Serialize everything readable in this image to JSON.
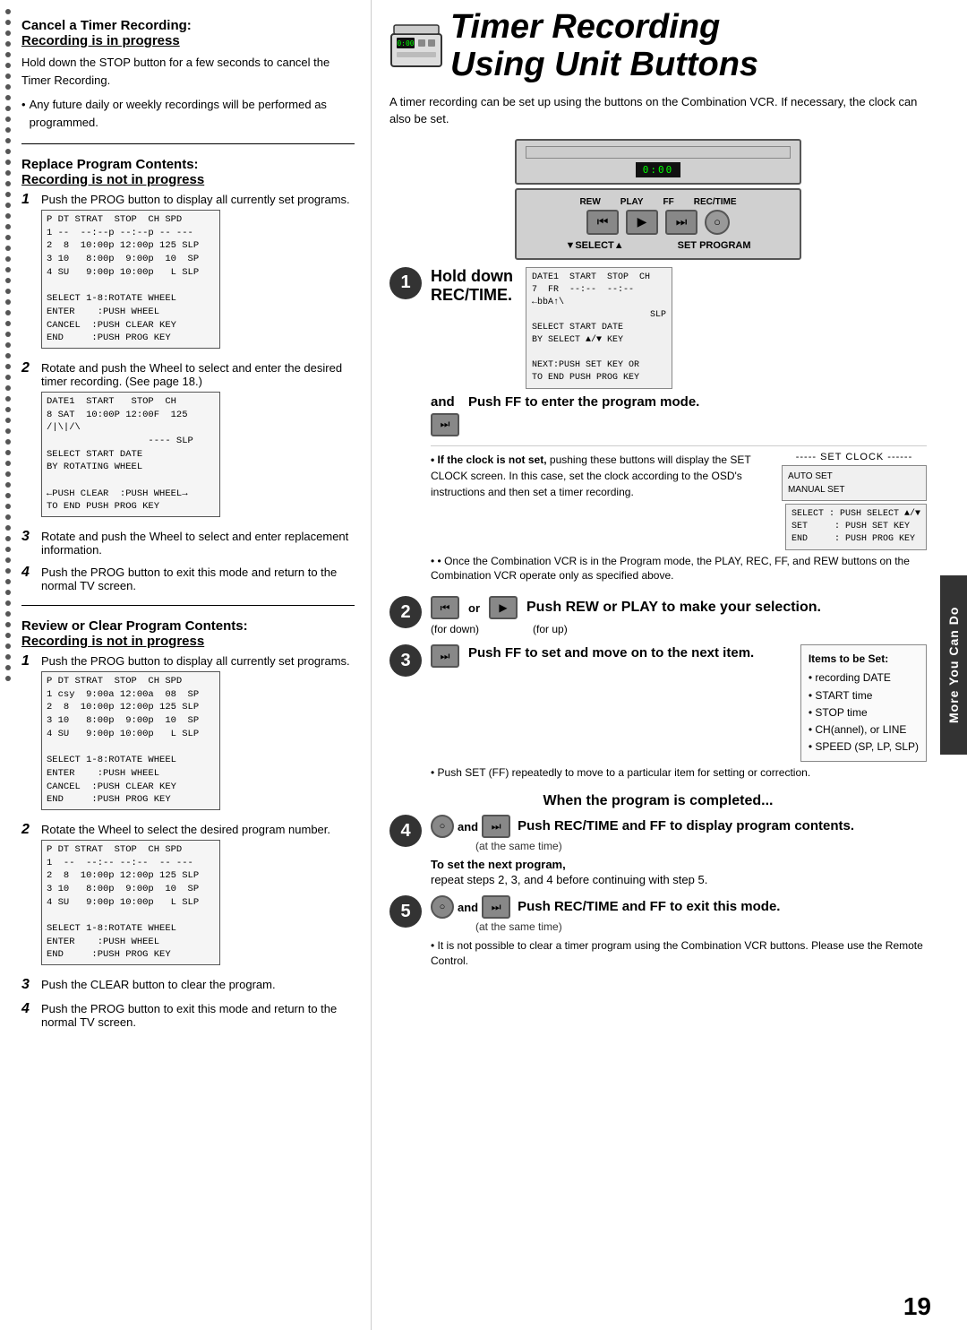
{
  "page": {
    "number": "19"
  },
  "title": {
    "line1": "Timer Recording",
    "line2": "Using Unit Buttons"
  },
  "right_sidebar_label": "More You Can Do",
  "intro": "A timer recording can be set up using the buttons on the Combination VCR. If necessary, the clock can also be set.",
  "vcr": {
    "display_text": "0:00",
    "button_labels": [
      "REW",
      "PLAY",
      "FF",
      "REC/TIME"
    ],
    "nav_label_left": "▼SELECT▲",
    "nav_label_right": "SET  PROGRAM"
  },
  "left": {
    "section1": {
      "title": "Cancel a Timer Recording:",
      "title2": "Recording is in progress",
      "body": "Hold down the STOP button for a few seconds to cancel the Timer Recording.",
      "bullet": "Any future daily or weekly recordings will be performed as programmed."
    },
    "section2": {
      "title": "Replace Program Contents:",
      "title2": "Recording is not in progress",
      "steps": [
        {
          "num": "1",
          "text_before": "Push the PROG button to display all currently set programs.",
          "screen": "P DT STRAT  STOP  CH SPD\n1 --  --:--p --:--p -- ---\n2  8  10:00p 12:00p 125 SLP\n3 10   8:00p  9:00p  10  SP\n4 SU   9:00p 10:00p   L SLP\n\nSELECT 1-8:ROTATE WHEEL\nENTER   :PUSH WHEEL\nCANCEL  :PUSH CLEAR KEY\nEND     :PUSH PROG KEY"
        },
        {
          "num": "2",
          "text_before": "Rotate and push the Wheel to select and enter the desired timer recording. (See page 18.)",
          "screen1": "DATE1  START   STOP  CH\n8 SAT  10:00P 12:00F  125\n/|\\|/\\\n                  ---- SLP\nSELECT START DATE\nBY ROTATING WHEEL\n\n←PUSH CLEAR  :PUSH WHEEL→\nTO END PUSH PROG KEY"
        },
        {
          "num": "3",
          "text_before": "Rotate and push the Wheel to select and enter replacement information."
        },
        {
          "num": "4",
          "text_before": "Push the PROG button to exit this mode and return to the normal TV screen."
        }
      ]
    },
    "section3": {
      "title": "Review or Clear Program Contents:",
      "title2": "Recording is not in progress",
      "steps": [
        {
          "num": "1",
          "text_before": "Push the PROG button to display all currently set programs.",
          "screen": "P DT STRAT  STOP  CH SPD\n1 csy  9:00a 12:00a  08  SP\n2  8  10:00p 12:00p 125 SLP\n3 10   8:00p  9:00p  10  SP\n4 SU   9:00p 10:00p   L SLP\n\nSELECT 1-8:ROTATE WHEEL\nENTER   :PUSH WHEEL\nCANCEL  :PUSH CLEAR KEY\nEND     :PUSH PROG KEY"
        },
        {
          "num": "2",
          "text_before": "Rotate the Wheel to select the desired program number.",
          "screen": "P DT STRAT  STOP  CH SPD\n1  --  --:-- --:--  -- ---\n2  8  10:00p 12:00p 125 SLP\n3 10   8:00p  9:00p  10  SP\n4 SU   9:00p 10:00p   L SLP\n\nSELECT 1-8:ROTATE WHEEL\nENTER   :PUSH WHEEL\nEND     :PUSH PROG KEY"
        },
        {
          "num": "3",
          "text_before": "Push the CLEAR button to clear the program."
        },
        {
          "num": "4",
          "text_before": "Push the PROG button to exit this mode and return to the normal TV screen."
        }
      ]
    }
  },
  "right": {
    "step1": {
      "circle": "1",
      "title": "Hold down",
      "subtitle": "REC/TIME.",
      "info_box": "DATE1  START  STOP  CH\n7  FR  --:--  --:--\n←bbA↑\\\n                       SLP\nSELECT START DATE\nBY SELECT ▲/▼ KEY\n\nNEXT:PUSH SET KEY OR\nTO END PUSH PROG KEY",
      "and_label": "and",
      "push_ff_text": "Push FF to enter the program mode.",
      "if_clock_title": "• If the clock is not set,",
      "if_clock_body": "pushing these buttons will display the SET CLOCK screen. In this case, set the clock according to the OSD's instructions and then set a timer recording.",
      "set_clock_dashes": "----- SET CLOCK ------",
      "auto_set": "AUTO SET\nMANUAL SET",
      "set_clock_keys": "SELECT : PUSH SELECT ▲/▼\nSET     : PUSH SET KEY\nEND     : PUSH PROG KEY",
      "once_combined": "• Once the Combination VCR is in the Program mode, the PLAY, REC, FF, and REW buttons on the Combination VCR operate only as specified above."
    },
    "step2": {
      "circle": "2",
      "push_text": "Push REW or PLAY to make your selection.",
      "for_down": "(for down)",
      "for_up": "(for up)"
    },
    "step3": {
      "circle": "3",
      "push_text": "Push FF to set and move on to the next item.",
      "items_title": "Items to be Set:",
      "items": [
        "• recording DATE",
        "• START time",
        "• STOP time",
        "• CH(annel), or LINE",
        "• SPEED (SP, LP, SLP)"
      ],
      "note": "• Push SET (FF) repeatedly to move to a particular item for setting or correction."
    },
    "completed_text": "When the program is completed...",
    "step4": {
      "circle": "4",
      "push_text": "Push REC/TIME and FF to display program contents.",
      "at_same_time": "(at the same time)",
      "next_program_label": "To set the next program,",
      "next_program_body": "repeat steps 2, 3, and 4 before continuing with step 5."
    },
    "step5": {
      "circle": "5",
      "push_text": "Push REC/TIME and FF to exit this mode.",
      "at_same_time": "(at the same time)",
      "note": "• It is not possible to clear a timer program using the Combination VCR buttons. Please use the Remote Control."
    }
  }
}
